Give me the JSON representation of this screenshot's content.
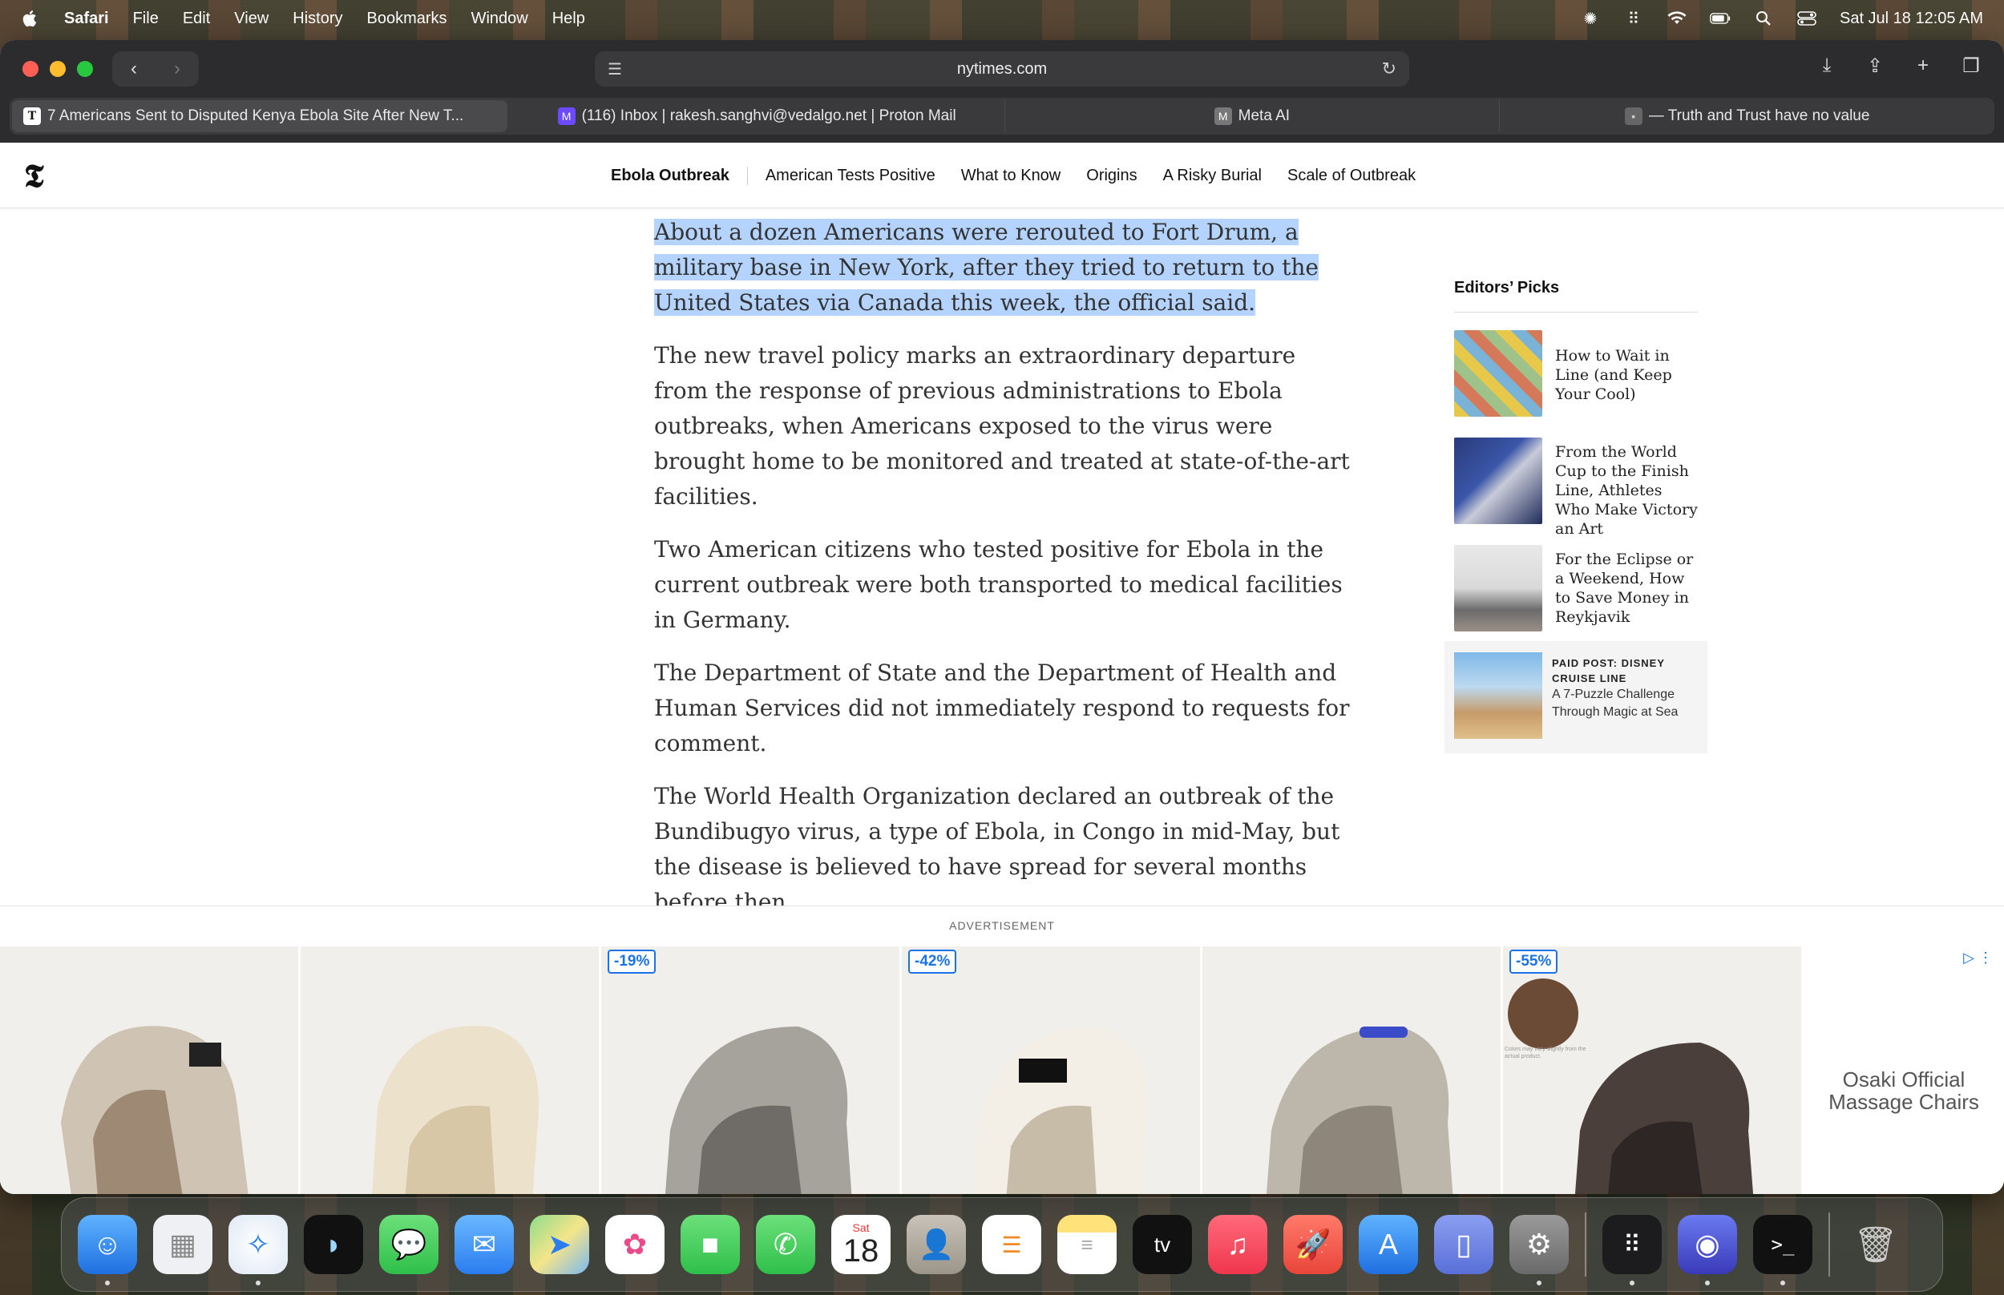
{
  "menubar": {
    "app": "Safari",
    "items": [
      "File",
      "Edit",
      "View",
      "History",
      "Bookmarks",
      "Window",
      "Help"
    ],
    "clock": "Sat Jul 18  12:05 AM"
  },
  "browser": {
    "url": "nytimes.com",
    "tabs": [
      {
        "label": "7 Americans Sent to Disputed Kenya Ebola Site After New T...",
        "favicon": "nyt-icon"
      },
      {
        "label": "(116) Inbox | rakesh.sanghvi@vedalgo.net | Proton Mail",
        "favicon": "proton-mail-icon"
      },
      {
        "label": "Meta AI",
        "favicon": "meta-ai-icon"
      },
      {
        "label": "— Truth and Trust have no value",
        "favicon": "page-icon"
      }
    ]
  },
  "nyt": {
    "logo": "𝕿",
    "nav": [
      "Ebola Outbreak",
      "American Tests Positive",
      "What to Know",
      "Origins",
      "A Risky Burial",
      "Scale of Outbreak"
    ]
  },
  "article": {
    "paragraphs": [
      "About a dozen Americans were rerouted to Fort Drum, a military base in New York, after they tried to return to the United States via Canada this week, the official said.",
      "The new travel policy marks an extraordinary departure from the response of previous administrations to Ebola outbreaks, when Americans exposed to the virus were brought home to be monitored and treated at state-of-the-art facilities.",
      "Two American citizens who tested positive for Ebola in the current outbreak were both transported to medical facilities in Germany.",
      "The Department of State and the Department of Health and Human Services did not immediately respond to requests for comment.",
      "The World Health Organization declared an outbreak of the Bundibugyo virus, a type of Ebola, in Congo in mid-May, but the disease is believed to have spread for several months before then."
    ]
  },
  "sidebar": {
    "heading": "Editors’ Picks",
    "picks": [
      {
        "title": "How to Wait in Line (and Keep Your Cool)"
      },
      {
        "title": "From the World Cup to the Finish Line, Athletes Who Make Victory an Art"
      },
      {
        "title": "For the Eclipse or a Weekend, How to Save Money in Reykjavik"
      }
    ],
    "paid": {
      "kicker": "PAID POST: DISNEY CRUISE LINE",
      "title": "A 7-Puzzle Challenge Through Magic at Sea"
    }
  },
  "ad": {
    "label": "ADVERTISEMENT",
    "discounts": [
      "-19%",
      "-42%",
      "-55%"
    ],
    "brand": "Osaki Official Massage Chairs",
    "swatch_note": "Colors may vary slightly from the actual product."
  },
  "dock": {
    "calendar_day": "Sat",
    "calendar_date": "18",
    "tv_label": "tv"
  },
  "colors": {
    "selection": "#b4d4ff",
    "ad_accent": "#1a73e8"
  }
}
